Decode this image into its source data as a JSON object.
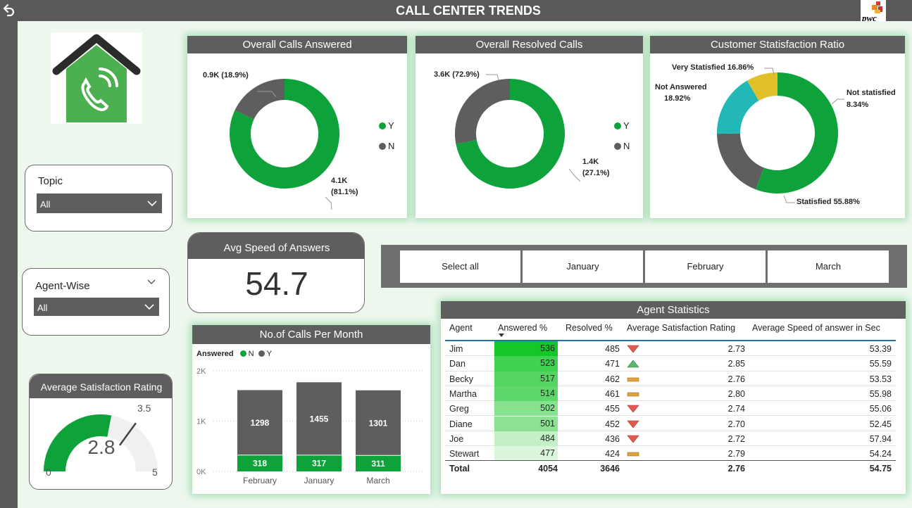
{
  "header": {
    "title": "CALL CENTER TRENDS",
    "back_icon": "back-arrow-icon",
    "logo_text": "pwc"
  },
  "colors": {
    "green": "#0ea23b",
    "gray": "#5e5e5e",
    "teal": "#22b8b8",
    "yellow": "#e2c02c"
  },
  "filters": {
    "topic": {
      "label": "Topic",
      "value": "All"
    },
    "agent": {
      "label": "Agent-Wise",
      "value": "All"
    }
  },
  "overall_answered": {
    "title": "Overall Calls Answered",
    "label_n": "0.9K (18.9%)",
    "label_y_1": "4.1K",
    "label_y_2": "(81.1%)",
    "legend": [
      "Y",
      "N"
    ]
  },
  "overall_resolved": {
    "title": "Overall Resolved Calls",
    "label_y": "3.6K (72.9%)",
    "label_n_1": "1.4K",
    "label_n_2": "(27.1%)",
    "legend": [
      "Y",
      "N"
    ]
  },
  "satisfaction_ratio": {
    "title": "Customer Statisfaction Ratio",
    "very": "Very Statisfied 16.86%",
    "not_answered_1": "Not Answered",
    "not_answered_2": "18.92%",
    "not_sat_1": "Not statisfied",
    "not_sat_2": "8.34%",
    "satisfied": "Statisfied 55.88%"
  },
  "avg_speed": {
    "title": "Avg Speed of Answers",
    "value": "54.7"
  },
  "months": {
    "select_all": "Select all",
    "items": [
      "January",
      "February",
      "March"
    ]
  },
  "avg_rating": {
    "title": "Average Satisfaction Rating",
    "value": "2.8",
    "min": "0",
    "max": "5",
    "target": "3.5"
  },
  "calls_per_month": {
    "title": "No.of Calls Per Month",
    "legend_title": "Answered",
    "legend_n": "N",
    "legend_y": "Y"
  },
  "agent_stats": {
    "title": "Agent Statistics",
    "columns": [
      "Agent",
      "Answered %",
      "Resolved %",
      "Average Satisfaction Rating",
      "Average Speed of answer in Sec"
    ],
    "total": {
      "label": "Total",
      "answered": "4054",
      "resolved": "3646",
      "rating": "2.76",
      "speed": "54.75"
    }
  },
  "chart_data": [
    {
      "type": "pie",
      "title": "Overall Calls Answered",
      "labels": [
        "Y",
        "N"
      ],
      "values": [
        4.1,
        0.9
      ],
      "percent": [
        81.1,
        18.9
      ],
      "unit": "K"
    },
    {
      "type": "pie",
      "title": "Overall Resolved Calls",
      "labels": [
        "Y",
        "N"
      ],
      "values": [
        3.6,
        1.4
      ],
      "percent": [
        72.9,
        27.1
      ],
      "unit": "K"
    },
    {
      "type": "pie",
      "title": "Customer Statisfaction Ratio",
      "labels": [
        "Statisfied",
        "Not Answered",
        "Very Statisfied",
        "Not statisfied"
      ],
      "values": [
        55.88,
        18.92,
        16.86,
        8.34
      ]
    },
    {
      "type": "bar",
      "title": "No.of Calls Per Month",
      "categories": [
        "February",
        "January",
        "March"
      ],
      "series": [
        {
          "name": "N",
          "values": [
            318,
            317,
            311
          ]
        },
        {
          "name": "Y",
          "values": [
            1298,
            1455,
            1301
          ]
        }
      ],
      "ylim": [
        0,
        2000
      ],
      "yticks": [
        "0K",
        "1K",
        "2K"
      ],
      "stacked": true
    },
    {
      "type": "table",
      "title": "Agent Statistics",
      "rows": [
        {
          "agent": "Jim",
          "answered": 536,
          "resolved": 485,
          "trend": "down",
          "rating": "2.73",
          "speed": "53.39"
        },
        {
          "agent": "Dan",
          "answered": 523,
          "resolved": 471,
          "trend": "up",
          "rating": "2.85",
          "speed": "55.59"
        },
        {
          "agent": "Becky",
          "answered": 517,
          "resolved": 462,
          "trend": "flat",
          "rating": "2.76",
          "speed": "53.53"
        },
        {
          "agent": "Martha",
          "answered": 514,
          "resolved": 461,
          "trend": "flat",
          "rating": "2.80",
          "speed": "55.98"
        },
        {
          "agent": "Greg",
          "answered": 502,
          "resolved": 455,
          "trend": "down",
          "rating": "2.74",
          "speed": "55.06"
        },
        {
          "agent": "Diane",
          "answered": 501,
          "resolved": 452,
          "trend": "down",
          "rating": "2.70",
          "speed": "52.45"
        },
        {
          "agent": "Joe",
          "answered": 484,
          "resolved": 436,
          "trend": "down",
          "rating": "2.72",
          "speed": "57.94"
        },
        {
          "agent": "Stewart",
          "answered": 477,
          "resolved": 424,
          "trend": "flat",
          "rating": "2.79",
          "speed": "54.24"
        }
      ]
    }
  ]
}
